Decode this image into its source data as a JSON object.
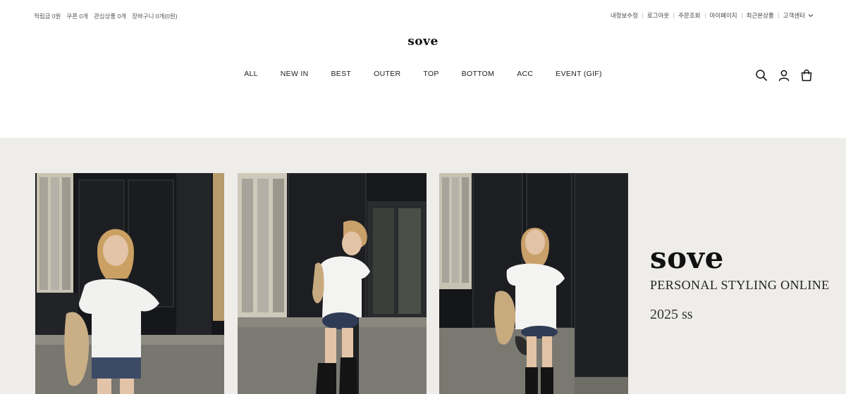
{
  "topbar": {
    "left_items": [
      "적립금 0원",
      "쿠폰 0개",
      "관심상품 0개",
      "장바구니 0개(0원)"
    ],
    "right_items": [
      "내정보수정",
      "로그아웃",
      "주문조회",
      "마이페이지",
      "최근본상품",
      "고객센터"
    ]
  },
  "logo": "sove",
  "nav": {
    "items": [
      "ALL",
      "NEW IN",
      "BEST",
      "OUTER",
      "TOP",
      "BOTTOM",
      "ACC",
      "EVENT (GIF)"
    ]
  },
  "icons": [
    "search-icon",
    "user-icon",
    "bag-icon",
    "chevron-down-icon"
  ],
  "hero": {
    "brand": "sove",
    "tagline": "PERSONAL STYLING ONLINE",
    "season": "2025 ss",
    "background": "#eeedea"
  }
}
